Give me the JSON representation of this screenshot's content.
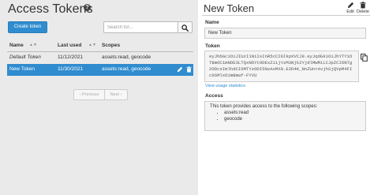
{
  "left": {
    "title": "Access Tokens",
    "create_button": "Create token",
    "search": {
      "placeholder": "Search for..."
    },
    "columns": [
      "Name",
      "Last used",
      "Scopes"
    ],
    "rows": [
      {
        "name": "Default Token",
        "last_used": "11/12/2021",
        "scopes": "assets:read, geocode",
        "selected": false
      },
      {
        "name": "New Token",
        "last_used": "11/30/2021",
        "scopes": "assets:read, geocode",
        "selected": true
      }
    ],
    "pager": {
      "prev": "‹ Previous",
      "next": "Next ›"
    }
  },
  "right": {
    "title": "New Token",
    "actions": {
      "edit": "Edit",
      "delete": "Delete"
    },
    "name_label": "Name",
    "name_value": "New Token",
    "token_label": "Token",
    "token_value": "eyJhbGciOiJIUzI1NiIsInR5cCI6IkpXVCJ9.eyJqdGkiOiJhYTY1OTBmOC1mNDE3LTQxNDYtODExZi1jYzM3Njk2YjdlMWMiLCJpZCI6NTg2ODcsImlhdCI6MTYzODI5NzAxMX0.E2D4K_NnZUnrAvjhSjQVpM4FIc0SMlxD1mBmaf-FYVU",
    "usage_link": "View usage statistics",
    "access_label": "Access",
    "access_text": "This token provides access to the following scopes:",
    "scopes": [
      "assets:read",
      "geocode"
    ]
  },
  "colors": {
    "accent": "#2f8ccf",
    "panel_bg": "#eaeaea"
  }
}
